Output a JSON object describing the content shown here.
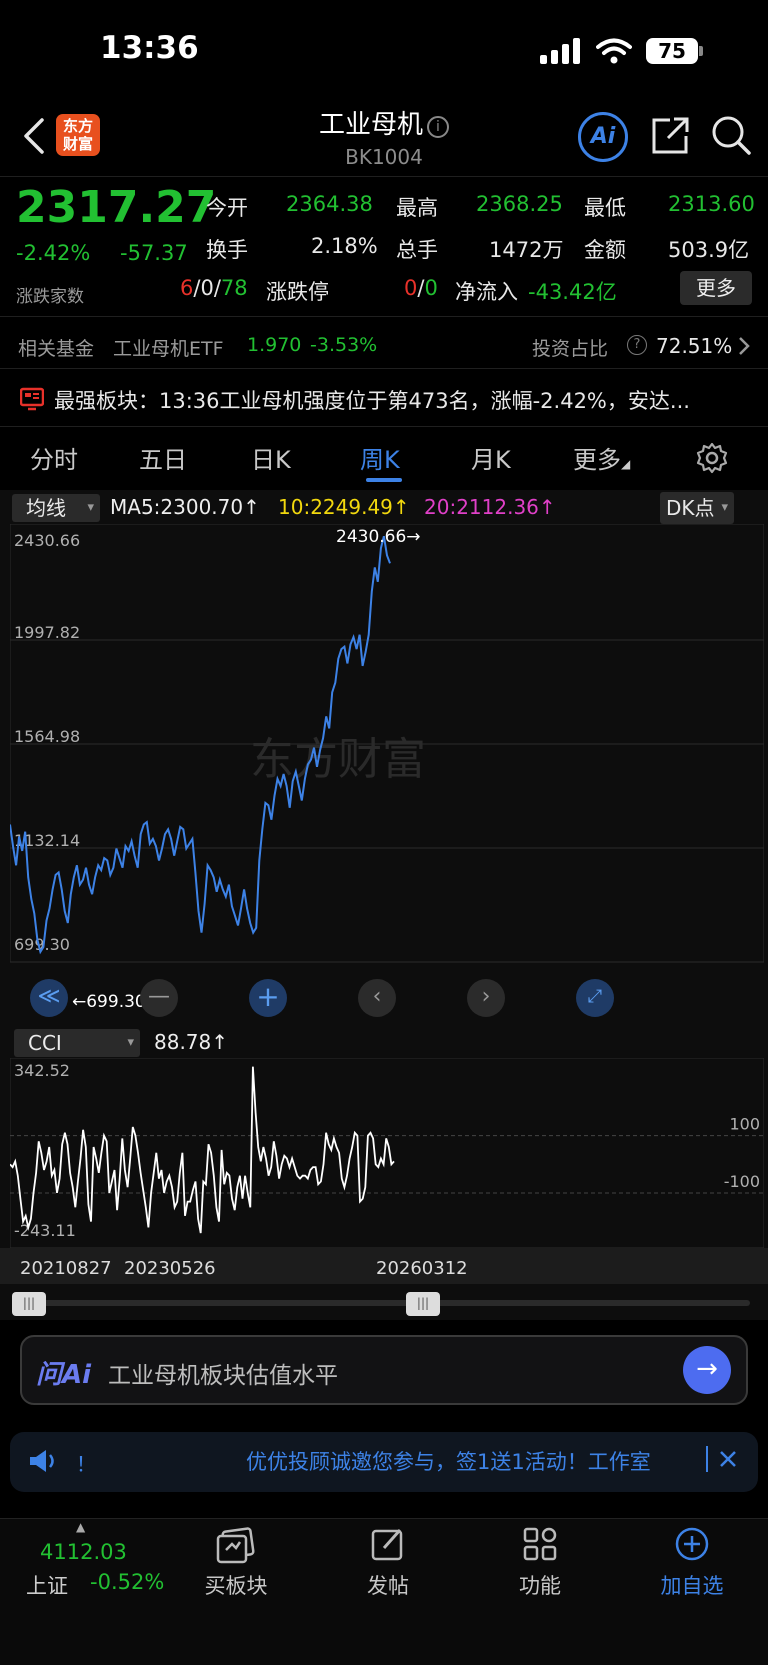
{
  "status_bar": {
    "time": "13:36",
    "battery": "75"
  },
  "header": {
    "logo": "东方\n财富",
    "title": "工业母机",
    "code": "BK1004",
    "ai_label": "Ai"
  },
  "quote": {
    "price": "2317.27",
    "change_pct": "-2.42%",
    "change_abs": "-57.37",
    "open_label": "今开",
    "open": "2364.38",
    "high_label": "最高",
    "high": "2368.25",
    "low_label": "最低",
    "low": "2313.60",
    "turnover_label": "换手",
    "turnover": "2.18%",
    "volume_label": "总手",
    "volume": "1472万",
    "amount_label": "金额",
    "amount": "503.9亿",
    "breadth_label": "涨跌家数",
    "breadth_up": "6",
    "breadth_flat": "0",
    "breadth_down": "78",
    "limit_label": "涨跌停",
    "limit_up": "0",
    "limit_down": "0",
    "netflow_label": "净流入",
    "netflow": "-43.42亿",
    "more_label": "更多"
  },
  "fund": {
    "label": "相关基金",
    "name": "工业母机ETF",
    "price": "1.970",
    "change": "-3.53%",
    "ratio_label": "投资占比",
    "ratio": "72.51%"
  },
  "news": {
    "text": "最强板块：13:36工业母机强度位于第473名，涨幅-2.42%，安达..."
  },
  "tabs": [
    "分时",
    "五日",
    "日K",
    "周K",
    "月K",
    "更多"
  ],
  "chart_controls": {
    "ma_select": "均线",
    "ma5": "MA5:2300.70↑",
    "ma10": "10:2249.49↑",
    "ma20": "20:2112.36↑",
    "dk_label": "DK点",
    "indicator_select": "CCI",
    "indicator_value": "88.78↑"
  },
  "chart_data": [
    {
      "type": "line",
      "yticks": [
        "2430.66",
        "1997.82",
        "1564.98",
        "1132.14",
        "699.30"
      ],
      "ylim": [
        699.3,
        2430.66
      ],
      "max_label": "2430.66→",
      "min_label": "←699.30",
      "series": [
        {
          "values": [
            1230,
            1140,
            1060,
            1180,
            1120,
            1200,
            1010,
            920,
            860,
            750,
            700,
            720,
            830,
            880,
            960,
            1020,
            1030,
            960,
            870,
            820,
            940,
            1010,
            1060,
            980,
            1000,
            1050,
            980,
            940,
            1010,
            1060,
            1040,
            1090,
            1080,
            1020,
            1050,
            1130,
            1090,
            1050,
            1140,
            1120,
            1160,
            1100,
            1050,
            1190,
            1230,
            1240,
            1150,
            1170,
            1140,
            1080,
            1130,
            1190,
            1210,
            1170,
            1100,
            1160,
            1220,
            1210,
            1130,
            1150,
            1170,
            1030,
            870,
            780,
            900,
            1060,
            1040,
            1010,
            950,
            1000,
            960,
            930,
            980,
            890,
            850,
            810,
            880,
            960,
            880,
            820,
            780,
            800,
            1080,
            1210,
            1320,
            1310,
            1250,
            1350,
            1420,
            1390,
            1440,
            1390,
            1300,
            1410,
            1450,
            1390,
            1330,
            1420,
            1480,
            1500,
            1550,
            1470,
            1540,
            1590,
            1680,
            1630,
            1780,
            1820,
            1920,
            1960,
            1970,
            1900,
            1980,
            2010,
            1960,
            2020,
            1890,
            1950,
            2020,
            2200,
            2300,
            2240,
            2380,
            2430,
            2350,
            2317
          ]
        }
      ]
    },
    {
      "type": "line",
      "title": "CCI",
      "yticks": [
        "342.52",
        "100",
        "-100",
        "-243.11"
      ],
      "ylim": [
        -243.11,
        342.52
      ],
      "xticks": [
        "20210827",
        "20230526",
        "20260312"
      ],
      "series": [
        {
          "name": "CCI",
          "values": [
            0,
            -10,
            10,
            -40,
            -120,
            -200,
            -180,
            -220,
            -190,
            -100,
            -30,
            80,
            40,
            -20,
            10,
            60,
            -40,
            -20,
            -100,
            -50,
            70,
            110,
            70,
            -30,
            -80,
            -150,
            -60,
            20,
            120,
            60,
            -140,
            -200,
            60,
            20,
            -30,
            40,
            100,
            80,
            -100,
            -60,
            -20,
            -160,
            -50,
            90,
            -20,
            -80,
            20,
            130,
            100,
            40,
            -30,
            -90,
            -150,
            -220,
            -100,
            -30,
            40,
            -50,
            -20,
            -100,
            -60,
            -40,
            -80,
            -150,
            -130,
            -30,
            40,
            -180,
            -130,
            -130,
            -90,
            -60,
            -190,
            -240,
            -60,
            -70,
            70,
            40,
            -40,
            -150,
            -200,
            50,
            -70,
            -30,
            -40,
            -120,
            -160,
            -80,
            -40,
            -120,
            -40,
            -100,
            -150,
            340,
            180,
            60,
            10,
            60,
            20,
            -40,
            -10,
            80,
            30,
            -50,
            0,
            30,
            20,
            -10,
            20,
            -10,
            -40,
            -50,
            -40,
            -40,
            -50,
            -20,
            -10,
            -10,
            -70,
            -60,
            0,
            110,
            70,
            50,
            90,
            60,
            40,
            -50,
            -80,
            -40,
            20,
            60,
            110,
            100,
            -130,
            -120,
            -80,
            100,
            110,
            90,
            0,
            -10,
            20,
            0,
            90,
            60,
            0,
            10
          ]
        }
      ]
    }
  ],
  "ask": {
    "brand": "问Ai",
    "prompt": "工业母机板块估值水平"
  },
  "promo": {
    "mark": "！",
    "text": "优优投顾诚邀您参与，签1送1活动！工作室"
  },
  "bottom_nav": {
    "index_value": "4112.03",
    "index_name": "上证",
    "index_change": "-0.52%",
    "items": [
      "买板块",
      "发帖",
      "功能",
      "加自选"
    ]
  },
  "colors": {
    "up": "#e8312a",
    "down": "#22c032",
    "accent": "#3d82e6",
    "line": "#3d82e6"
  },
  "icons": [
    "back-icon",
    "info-icon",
    "share-icon",
    "search-icon",
    "settings-icon",
    "speaker-icon",
    "close-icon"
  ]
}
